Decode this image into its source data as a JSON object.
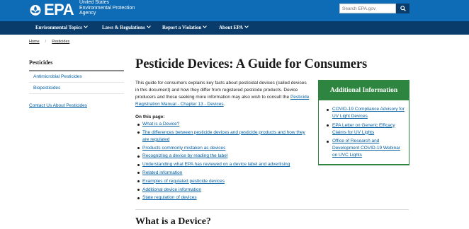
{
  "header": {
    "logo_text": "EPA",
    "agency_lines": [
      "United States",
      "Environmental Protection",
      "Agency"
    ],
    "search_placeholder": "Search EPA.gov",
    "brand_color": "#0e6cb6",
    "nav_color": "#0a3c6b"
  },
  "nav": {
    "items": [
      {
        "label": "Environmental Topics",
        "icon": "chevron-down-icon"
      },
      {
        "label": "Laws & Regulations",
        "icon": "chevron-down-icon"
      },
      {
        "label": "Report a Violation",
        "icon": "chevron-down-icon"
      },
      {
        "label": "About EPA",
        "icon": "chevron-down-icon"
      }
    ]
  },
  "breadcrumb": [
    "Home",
    "Pesticides"
  ],
  "sidebar": {
    "title": "Pesticides",
    "items": [
      "Antimicrobial Pesticides",
      "Biopesticides"
    ],
    "contact_link": "Contact Us About Pesticides"
  },
  "main": {
    "title": "Pesticide Devices: A Guide for Consumers",
    "intro_text": "This guide for consumers explains key facts about pesticidal devices (called devices in this document) and how they differ from registered pesticide products. Device producers and those seeking more information may also wish to consult the ",
    "intro_link": "Pesticide Registration Manual - Chapter 13 - Devices",
    "intro_end": ".",
    "on_this_page": "On this page:",
    "toc": [
      "What is a Device?",
      "The differences between pesticide devices and pesticide products and how they are regulated",
      "Products commonly mistaken as devices",
      "Recognizing a device by reading the label",
      "Understanding what EPA has reviewed on a device label and advertising",
      "Related information",
      "Examples of regulated pesticide devices",
      "Additional device information",
      "State regulation of devices"
    ],
    "section_heading": "What is a Device?"
  },
  "info_box": {
    "title": "Additional Information",
    "accent_color": "#2e8540",
    "links": [
      "COVID-19 Compliance Advisory for UV Light Devices",
      "EPA Letter on Generic Efficacy Claims for UV Lights",
      "Office of Research and Development COVID-19 Webinar on UVC Lights"
    ]
  }
}
